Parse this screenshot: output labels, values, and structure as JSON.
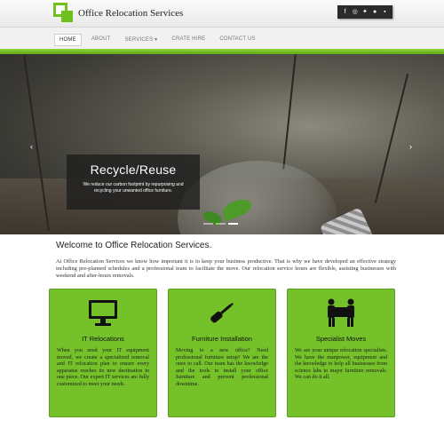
{
  "header": {
    "brand": "Office Relocation Services",
    "social_icons": [
      "facebook-icon",
      "instagram-icon",
      "twitter-icon",
      "pinterest-icon",
      "linkedin-icon"
    ]
  },
  "nav": {
    "items": [
      {
        "label": "HOME",
        "active": true
      },
      {
        "label": "ABOUT"
      },
      {
        "label": "SERVICES ▾"
      },
      {
        "label": "CRATE HIRE"
      },
      {
        "label": "CONTACT US"
      }
    ]
  },
  "hero": {
    "title": "Recycle/Reuse",
    "text": "We reduce our carbon footprint by repurposing and recycling your unwanted office furniture.",
    "prev": "‹",
    "next": "›",
    "slides": 3,
    "active_slide": 3
  },
  "welcome": {
    "heading": "Welcome to Office Relocation Services.",
    "body": "At Office Relocation Services we know how important it is to keep your business productive. That is why we have developed an effective strategy including pre-planned schedules and a professional team to facilitate the move. Our relocation service hours are flexible, assisting businesses with weekend and after-hours removals."
  },
  "cards": [
    {
      "icon": "monitor-icon",
      "title": "IT Relocations",
      "text": "When you need your IT equipment moved, we create a specialized removal and IT relocation plan to ensure every apparatus reaches its new destination in one piece. Our expert IT services are fully customized to meet your needs."
    },
    {
      "icon": "screwdriver-icon",
      "title": "Furniture Installation",
      "text": "Moving to a new office? Need professional furniture setup? We are the ones to call. Our team has the knowledge and the tools to install your office furniture and prevent professional downtime."
    },
    {
      "icon": "movers-icon",
      "title": "Specialist Moves",
      "text": "We are your unique relocation specialists. We have the manpower, equipment and the knowledge to help all businesses from science labs to major furniture removals. We can do it all."
    }
  ],
  "colors": {
    "accent": "#74c12a",
    "dark": "#2b2b2b"
  }
}
